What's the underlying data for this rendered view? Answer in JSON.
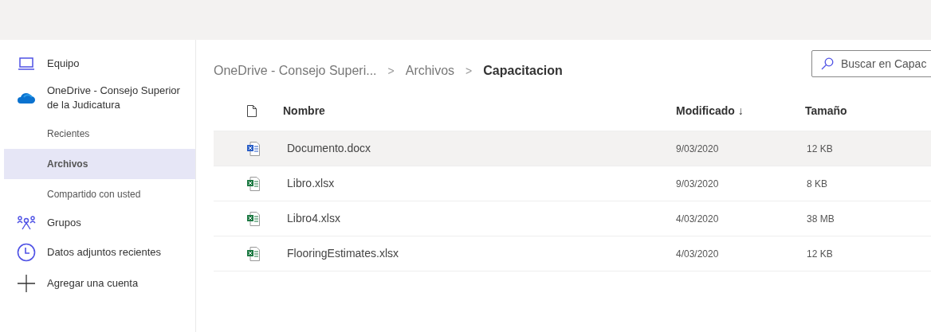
{
  "sidebar": {
    "items": [
      {
        "label": "Equipo",
        "kind": "laptop",
        "selected": false
      },
      {
        "label": "OneDrive - Consejo Superior de la Judicatura",
        "kind": "cloud",
        "selected": false
      },
      {
        "label": "Recientes",
        "kind": "sub",
        "selected": false
      },
      {
        "label": "Archivos",
        "kind": "sub",
        "selected": true
      },
      {
        "label": "Compartido con usted",
        "kind": "sub",
        "selected": false
      },
      {
        "label": "Grupos",
        "kind": "people",
        "selected": false
      },
      {
        "label": "Datos adjuntos recientes",
        "kind": "clock",
        "selected": false
      },
      {
        "label": "Agregar una cuenta",
        "kind": "plus",
        "selected": false
      }
    ]
  },
  "breadcrumb": [
    "OneDrive - Consejo Superi...",
    "Archivos",
    "Capacitacion"
  ],
  "breadcrumb_separators": [
    ">",
    ">"
  ],
  "search": {
    "placeholder": "Buscar en Capac"
  },
  "table": {
    "columns": [
      "Nombre",
      "Modificado ↓",
      "Tamaño"
    ],
    "rows": [
      {
        "name": "Documento.docx",
        "kind": "word",
        "modified": "9/03/2020",
        "size": "12 KB",
        "selected": true
      },
      {
        "name": "Libro.xlsx",
        "kind": "excel",
        "modified": "9/03/2020",
        "size": "8 KB",
        "selected": false
      },
      {
        "name": "Libro4.xlsx",
        "kind": "excel",
        "modified": "4/03/2020",
        "size": "38 MB",
        "selected": false
      },
      {
        "name": "FlooringEstimates.xlsx",
        "kind": "excel",
        "modified": "4/03/2020",
        "size": "12 KB",
        "selected": false
      }
    ]
  }
}
